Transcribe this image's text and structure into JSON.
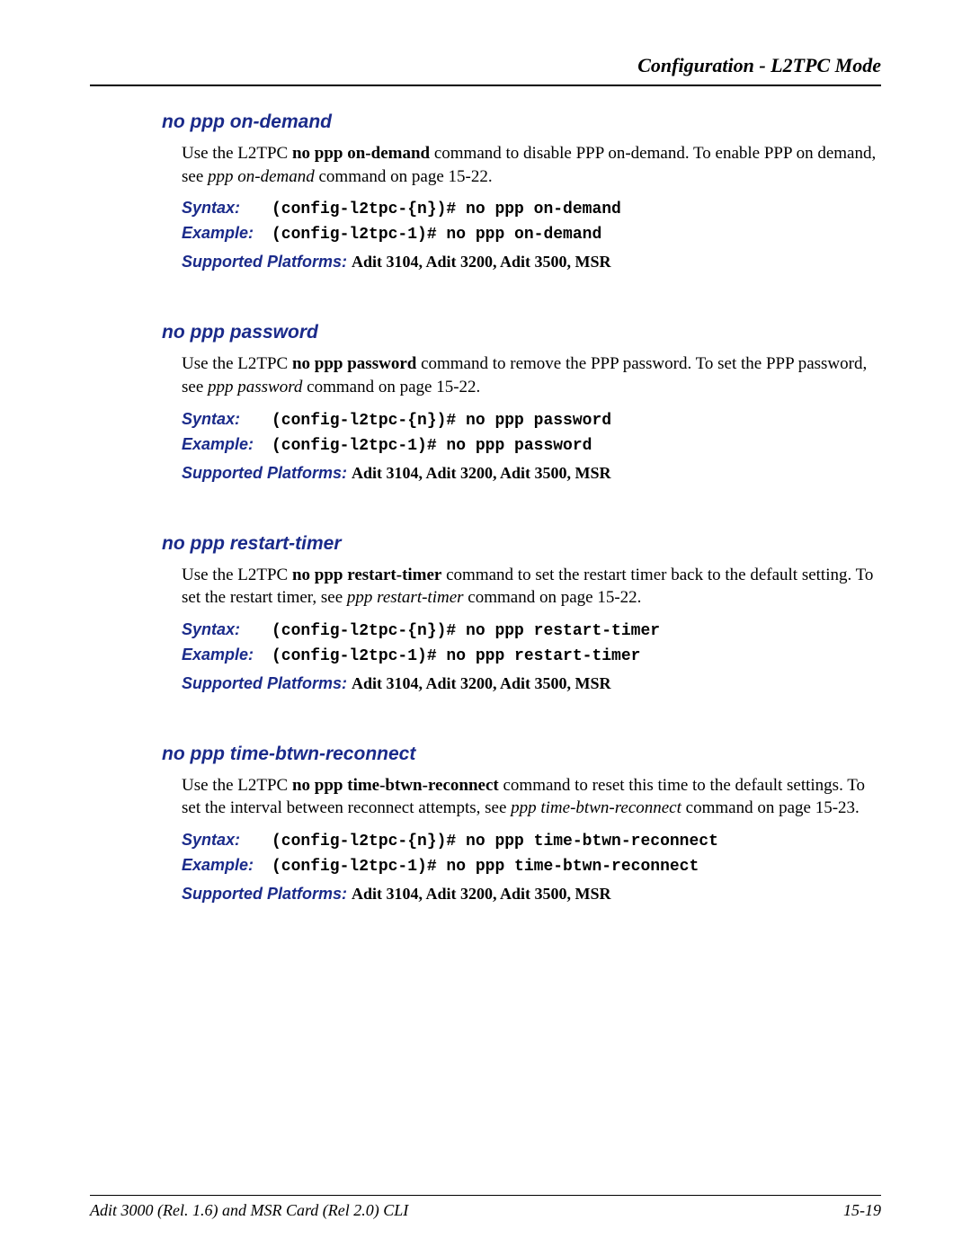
{
  "header": {
    "running": "Configuration - L2TPC Mode"
  },
  "sections": [
    {
      "title": "no ppp on-demand",
      "intro_pre": "Use the L2TPC ",
      "intro_cmd": "no ppp on-demand",
      "intro_mid": " command to disable PPP on-demand. To enable PPP on demand, see ",
      "intro_ref": "ppp on-demand",
      "intro_post": " command on page 15-22.",
      "syntax": "(config-l2tpc-{n})# no ppp on-demand",
      "example": "(config-l2tpc-1)# no ppp on-demand",
      "platforms": "Adit 3104, Adit 3200, Adit 3500, MSR"
    },
    {
      "title": "no ppp password",
      "intro_pre": "Use the L2TPC ",
      "intro_cmd": "no ppp password",
      "intro_mid": " command to remove the PPP password. To set the PPP password, see ",
      "intro_ref": "ppp password",
      "intro_post": " command on page 15-22.",
      "syntax": "(config-l2tpc-{n})# no ppp password",
      "example": "(config-l2tpc-1)# no ppp password",
      "platforms": "Adit 3104, Adit 3200, Adit 3500, MSR"
    },
    {
      "title": "no ppp restart-timer",
      "intro_pre": "Use the L2TPC ",
      "intro_cmd": "no ppp restart-timer",
      "intro_mid": " command to set the restart timer back to the default setting. To set the restart timer, see ",
      "intro_ref": "ppp restart-timer",
      "intro_post": " command on page 15-22.",
      "syntax": "(config-l2tpc-{n})# no ppp restart-timer",
      "example": "(config-l2tpc-1)# no ppp restart-timer",
      "platforms": "Adit 3104, Adit 3200, Adit 3500, MSR"
    },
    {
      "title": "no ppp time-btwn-reconnect",
      "intro_pre": "Use the L2TPC ",
      "intro_cmd": "no ppp time-btwn-reconnect",
      "intro_mid": " command to reset this time to the default settings. To set the interval between reconnect attempts, see ",
      "intro_ref": "ppp time-btwn-reconnect",
      "intro_post": " command on page 15-23.",
      "syntax": "(config-l2tpc-{n})# no ppp time-btwn-reconnect",
      "example": "(config-l2tpc-1)# no ppp time-btwn-reconnect",
      "platforms": "Adit 3104, Adit 3200, Adit 3500, MSR"
    }
  ],
  "labels": {
    "syntax": "Syntax:",
    "example": "Example:",
    "platforms": "Supported Platforms:  "
  },
  "footer": {
    "left": "Adit 3000 (Rel. 1.6) and MSR Card (Rel 2.0) CLI",
    "right": "15-19"
  }
}
